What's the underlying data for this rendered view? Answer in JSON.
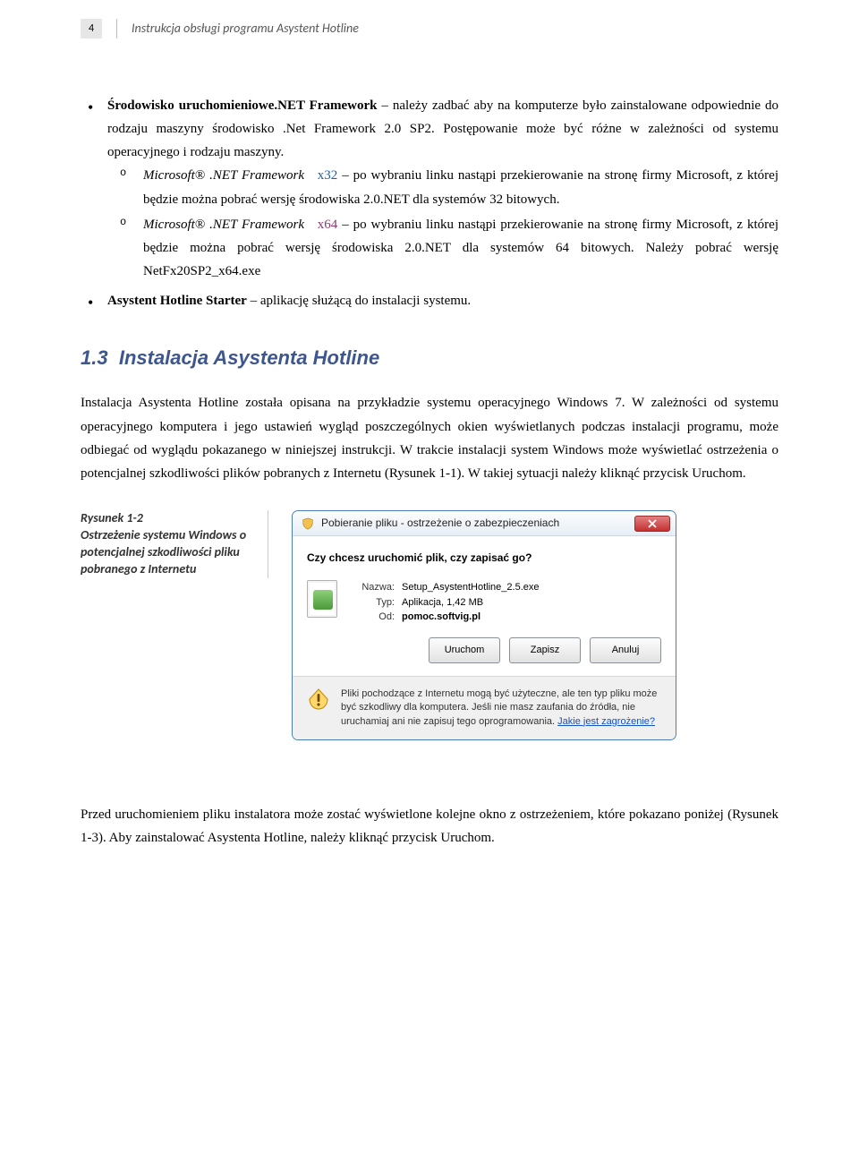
{
  "header": {
    "page_number": "4",
    "title": "Instrukcja obsługi programu Asystent Hotline"
  },
  "bullets": {
    "item1": {
      "lead": "Środowisko uruchomieniowe.NET Framework",
      "rest": " – należy zadbać aby na komputerze było zainstalowane odpowiednie do rodzaju maszyny środowisko .Net Framework 2.0 SP2. Postępowanie może być różne w zależności od systemu operacyjnego i rodzaju maszyny."
    },
    "sub1": {
      "lead_ital": "Microsoft® .NET Framework",
      "lead_link": "x32",
      "rest": " – po wybraniu linku nastąpi przekierowanie na stronę firmy Microsoft, z której będzie można pobrać wersję środowiska 2.0.NET dla systemów 32 bitowych."
    },
    "sub2": {
      "lead_ital": "Microsoft® .NET Framework",
      "lead_link": "x64",
      "rest": " – po wybraniu linku nastąpi przekierowanie na stronę firmy Microsoft, z której będzie można pobrać wersję środowiska 2.0.NET dla systemów 64 bitowych. Należy pobrać wersję NetFx20SP2_x64.exe"
    },
    "item2": {
      "lead": "Asystent Hotline Starter",
      "rest": " – aplikację służącą do instalacji systemu."
    }
  },
  "section": {
    "number": "1.3",
    "title": "Instalacja Asystenta Hotline"
  },
  "para1": "Instalacja Asystenta Hotline została opisana na przykładzie systemu operacyjnego Windows 7. W zależności od systemu operacyjnego komputera i jego ustawień wygląd poszczególnych okien wyświetlanych podczas instalacji programu, może odbiegać od wyglądu pokazanego w niniejszej instrukcji. W trakcie instalacji system Windows może wyświetlać ostrzeżenia o potencjalnej szkodliwości plików pobranych z Internetu (Rysunek 1-1). W takiej sytuacji należy kliknąć przycisk Uruchom.",
  "fig_caption": "Rysunek 1-2\nOstrzeżenie systemu Windows o potencjalnej szkodliwości pliku pobranego z Internetu",
  "dialog": {
    "title": "Pobieranie pliku - ostrzeżenie o zabezpieczeniach",
    "question": "Czy chcesz uruchomić plik, czy zapisać go?",
    "fields": {
      "name_k": "Nazwa:",
      "name_v": "Setup_AsystentHotline_2.5.exe",
      "type_k": "Typ:",
      "type_v": "Aplikacja, 1,42 MB",
      "from_k": "Od:",
      "from_v": "pomoc.softvig.pl"
    },
    "buttons": {
      "run": "Uruchom",
      "save": "Zapisz",
      "cancel": "Anuluj"
    },
    "footer_text": "Pliki pochodzące z Internetu mogą być użyteczne, ale ten typ pliku może być szkodliwy dla komputera. Jeśli nie masz zaufania do źródła, nie uruchamiaj ani nie zapisuj tego oprogramowania.",
    "footer_link": "Jakie jest zagrożenie?"
  },
  "para2": "Przed uruchomieniem pliku instalatora może zostać wyświetlone kolejne okno z ostrzeżeniem, które pokazano poniżej (Rysunek 1-3). Aby zainstalować Asystenta Hotline, należy kliknąć przycisk Uruchom."
}
